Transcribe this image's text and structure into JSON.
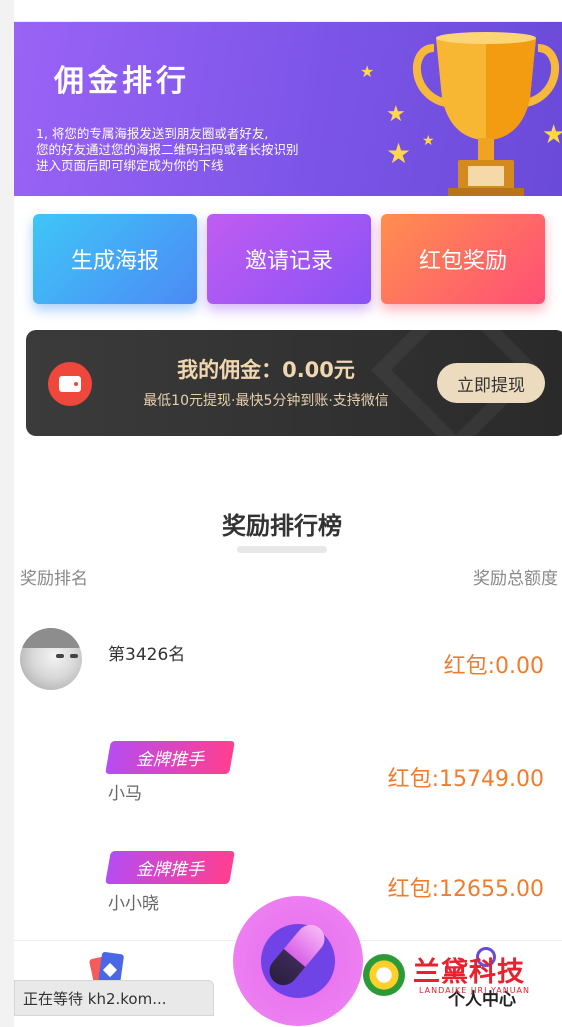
{
  "banner": {
    "title": "佣金排行",
    "desc_lines": [
      "1, 将您的专属海报发送到朋友圈或者好友,",
      "您的好友通过您的海报二维码扫码或者长按识别",
      "进入页面后即可绑定成为你的下线"
    ]
  },
  "actions": [
    {
      "label": "生成海报"
    },
    {
      "label": "邀请记录"
    },
    {
      "label": "红包奖励"
    }
  ],
  "commission": {
    "amount": "我的佣金：0.00元",
    "note": "最低10元提现·最快5分钟到账·支持微信",
    "withdraw_label": "立即提现"
  },
  "leaderboard": {
    "title": "奖励排行榜",
    "col_left": "奖励排名",
    "col_right": "奖励总额度",
    "me": {
      "rank": "第3426名",
      "sub": "",
      "amount": "红包:0.00"
    },
    "rows": [
      {
        "badge": "金牌推手",
        "name": "小马",
        "amount": "红包:15749.00"
      },
      {
        "badge": "金牌推手",
        "name": "小小晓",
        "amount": "红包:12655.00"
      }
    ]
  },
  "nav": {
    "right_label": "个人中心"
  },
  "status": {
    "loading": "正在等待 kh2.kom..."
  },
  "watermark": {
    "text": "兰黛科技",
    "sub": "LANDAIKE JIRI YANUAN"
  }
}
